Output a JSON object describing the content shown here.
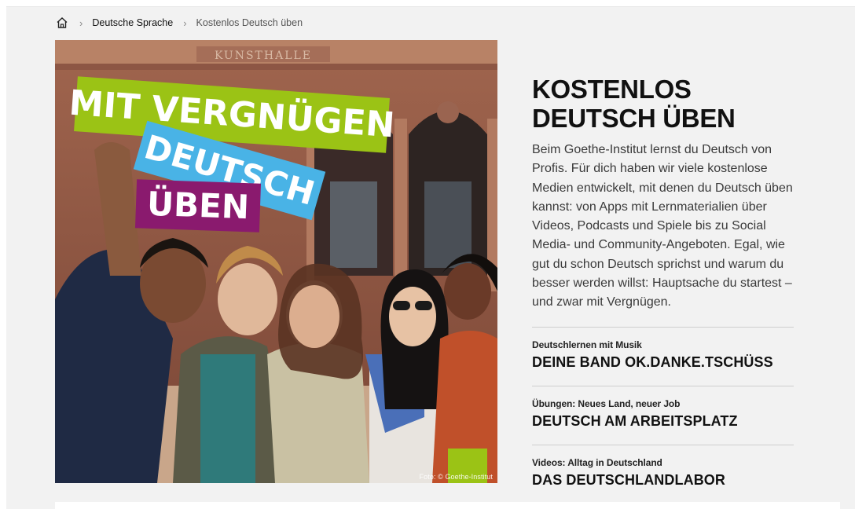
{
  "breadcrumb": {
    "home_icon": "home-icon",
    "separator": "›",
    "items": [
      {
        "label": "Deutsche Sprache"
      },
      {
        "label": "Kostenlos Deutsch üben"
      }
    ]
  },
  "hero": {
    "banner_line1": "MIT VERGNÜGEN",
    "banner_line2": "DEUTSCH",
    "banner_line3": "ÜBEN",
    "building_sign": "KUNSTHALLE",
    "photo_credit": "Foto: © Goethe-Institut",
    "colors": {
      "banner_green": "#9bc315",
      "banner_blue": "#49b3e6",
      "banner_purple": "#8a1a6e"
    }
  },
  "main": {
    "headline_line1": "KOSTENLOS",
    "headline_line2": "DEUTSCH ÜBEN",
    "intro": "Beim Goethe-Institut lernst du Deutsch von Profis. Für dich haben wir viele kostenlose Medien entwickelt, mit denen du Deutsch üben kannst: von Apps mit Lernmaterialien über Videos, Podcasts und Spiele bis zu Social Media- und Community-Angeboten. Egal, wie gut du schon Deutsch sprichst und warum du besser werden willst: Hauptsache du startest – und zwar mit Vergnügen."
  },
  "links": [
    {
      "kicker": "Deutschlernen mit Musik",
      "title": "DEINE BAND OK.DANKE.TSCHÜSS"
    },
    {
      "kicker": "Übungen: Neues Land, neuer Job",
      "title": "DEUTSCH AM ARBEITSPLATZ"
    },
    {
      "kicker": "Videos: Alltag in Deutschland",
      "title": "DAS DEUTSCHLANDLABOR"
    }
  ]
}
